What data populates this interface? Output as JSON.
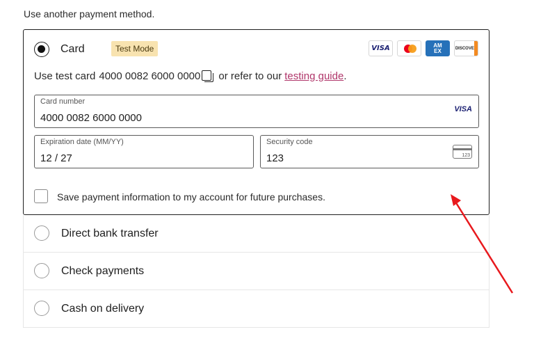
{
  "intro_text": "Use another payment method.",
  "card_method": {
    "label": "Card",
    "badge": "Test Mode",
    "logos": {
      "visa": "VISA",
      "amex": "AM\nEX",
      "discover": "DISCOVER"
    },
    "test_prefix": "Use test card",
    "test_number": "4000 0082 6000 0000",
    "test_middle": "or refer to our",
    "test_link": "testing guide",
    "test_suffix": ".",
    "card_number_label": "Card number",
    "card_number_value": "4000 0082 6000 0000",
    "card_brand": "VISA",
    "expiration_label": "Expiration date (MM/YY)",
    "expiration_value": "12 / 27",
    "security_label": "Security code",
    "security_value": "123",
    "cvc_icon_text": "123",
    "save_label": "Save payment information to my account for future purchases."
  },
  "other_methods": [
    {
      "label": "Direct bank transfer"
    },
    {
      "label": "Check payments"
    },
    {
      "label": "Cash on delivery"
    }
  ],
  "colors": {
    "link": "#b0366a",
    "badge": "#f8e3b0",
    "arrow": "#e8191d"
  }
}
